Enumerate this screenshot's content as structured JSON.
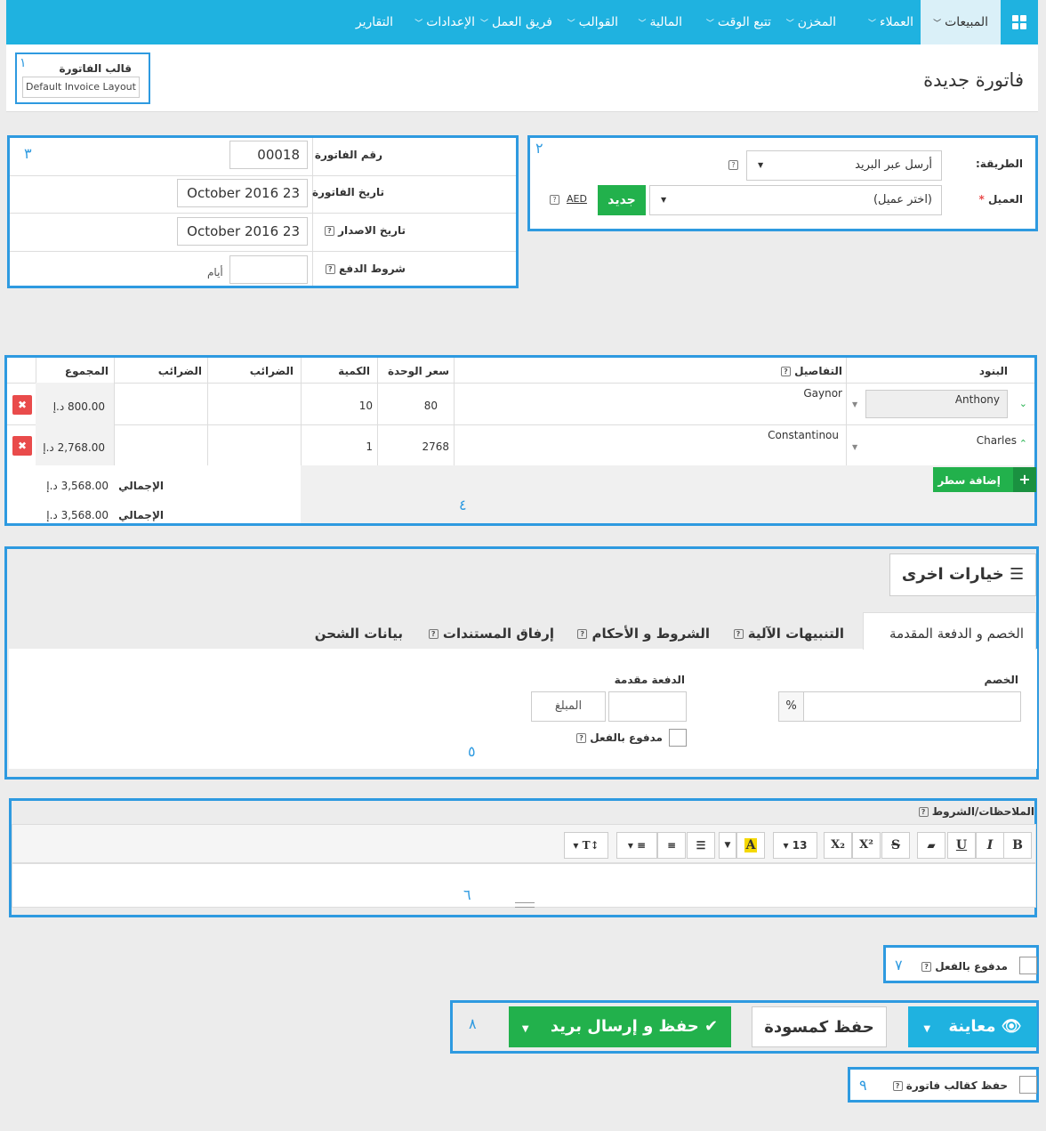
{
  "nav": {
    "home_icon": "grid-icon",
    "items": [
      {
        "label": "المبيعات",
        "dropdown": true,
        "active": true
      },
      {
        "label": "العملاء",
        "dropdown": true
      },
      {
        "label": "المخزن",
        "dropdown": true
      },
      {
        "label": "تتبع الوقت",
        "dropdown": true
      },
      {
        "label": "المالية",
        "dropdown": true
      },
      {
        "label": "القوالب",
        "dropdown": true
      },
      {
        "label": "فريق العمل",
        "dropdown": true
      },
      {
        "label": "الإعدادات",
        "dropdown": true
      },
      {
        "label": "التقارير",
        "dropdown": false
      }
    ]
  },
  "header": {
    "title": "فاتورة جديدة",
    "template_label": "قالب الفاتورة",
    "template_value": "Default Invoice Layout",
    "marker": "١"
  },
  "method": {
    "marker": "٢",
    "method_label": "الطريقة:",
    "method_value": "أرسل عبر البريد",
    "client_label": "العميل",
    "required_star": "*",
    "client_placeholder": "(اختر عميل)",
    "new_button": "جديد",
    "currency": "AED"
  },
  "invoice_info": {
    "marker": "٣",
    "number_label": "رقم الفاتورة",
    "number_value": "00018",
    "date_label": "تاريخ الفاتورة",
    "date_value": "23 October 2016",
    "issue_label": "تاريخ الاصدار",
    "issue_value": "23 October 2016",
    "terms_label": "شروط الدفع",
    "terms_unit": "أيام"
  },
  "items_table": {
    "marker": "٤",
    "headers": {
      "item": "البنود",
      "details": "التفاصيل",
      "unit_price": "سعر الوحدة",
      "qty": "الكمية",
      "tax1": "الضرائب",
      "tax2": "الضرائب",
      "total": "المجموع"
    },
    "rows": [
      {
        "item": "Anthony",
        "details": "Gaynor",
        "unit_price": "80",
        "qty": "10",
        "total": "800.00 د.إ"
      },
      {
        "item": "Charles",
        "details": "Constantinou",
        "unit_price": "2768",
        "qty": "1",
        "total": "2,768.00 د.إ"
      }
    ],
    "add_row": "إضافة سطر",
    "subtotal_label": "الإجمالي",
    "subtotal_value": "3,568.00 د.إ",
    "total_label": "الإجمالي",
    "total_value": "3,568.00 د.إ"
  },
  "options": {
    "marker": "٥",
    "title": "خيارات اخرى",
    "tabs": [
      "الخصم و الدفعة المقدمة",
      "التنبيهات الآلية",
      "الشروط و الأحكام",
      "إرفاق المستندات",
      "بيانات الشحن"
    ],
    "discount_label": "الخصم",
    "discount_unit": "%",
    "deposit_label": "الدفعة مقدمة",
    "deposit_placeholder": "المبلغ",
    "paid_label": "مدفوع بالفعل"
  },
  "notes": {
    "marker": "٦",
    "label": "الملاحظات/الشروط",
    "font_size": "13",
    "toolbar": [
      "B",
      "I",
      "U",
      "S",
      "X²",
      "X₂"
    ]
  },
  "paid": {
    "marker": "٧",
    "label": "مدفوع بالفعل"
  },
  "actions": {
    "marker": "٨",
    "preview": "معاينة",
    "draft": "حفظ كمسودة",
    "save_send": "حفظ و إرسال بريد"
  },
  "save_template": {
    "marker": "٩",
    "label": "حفظ كقالب فاتورة"
  },
  "colors": {
    "accent": "#1fb2e0",
    "green": "#22b14c",
    "red": "#e94b4b",
    "box": "#2e9ae0"
  }
}
